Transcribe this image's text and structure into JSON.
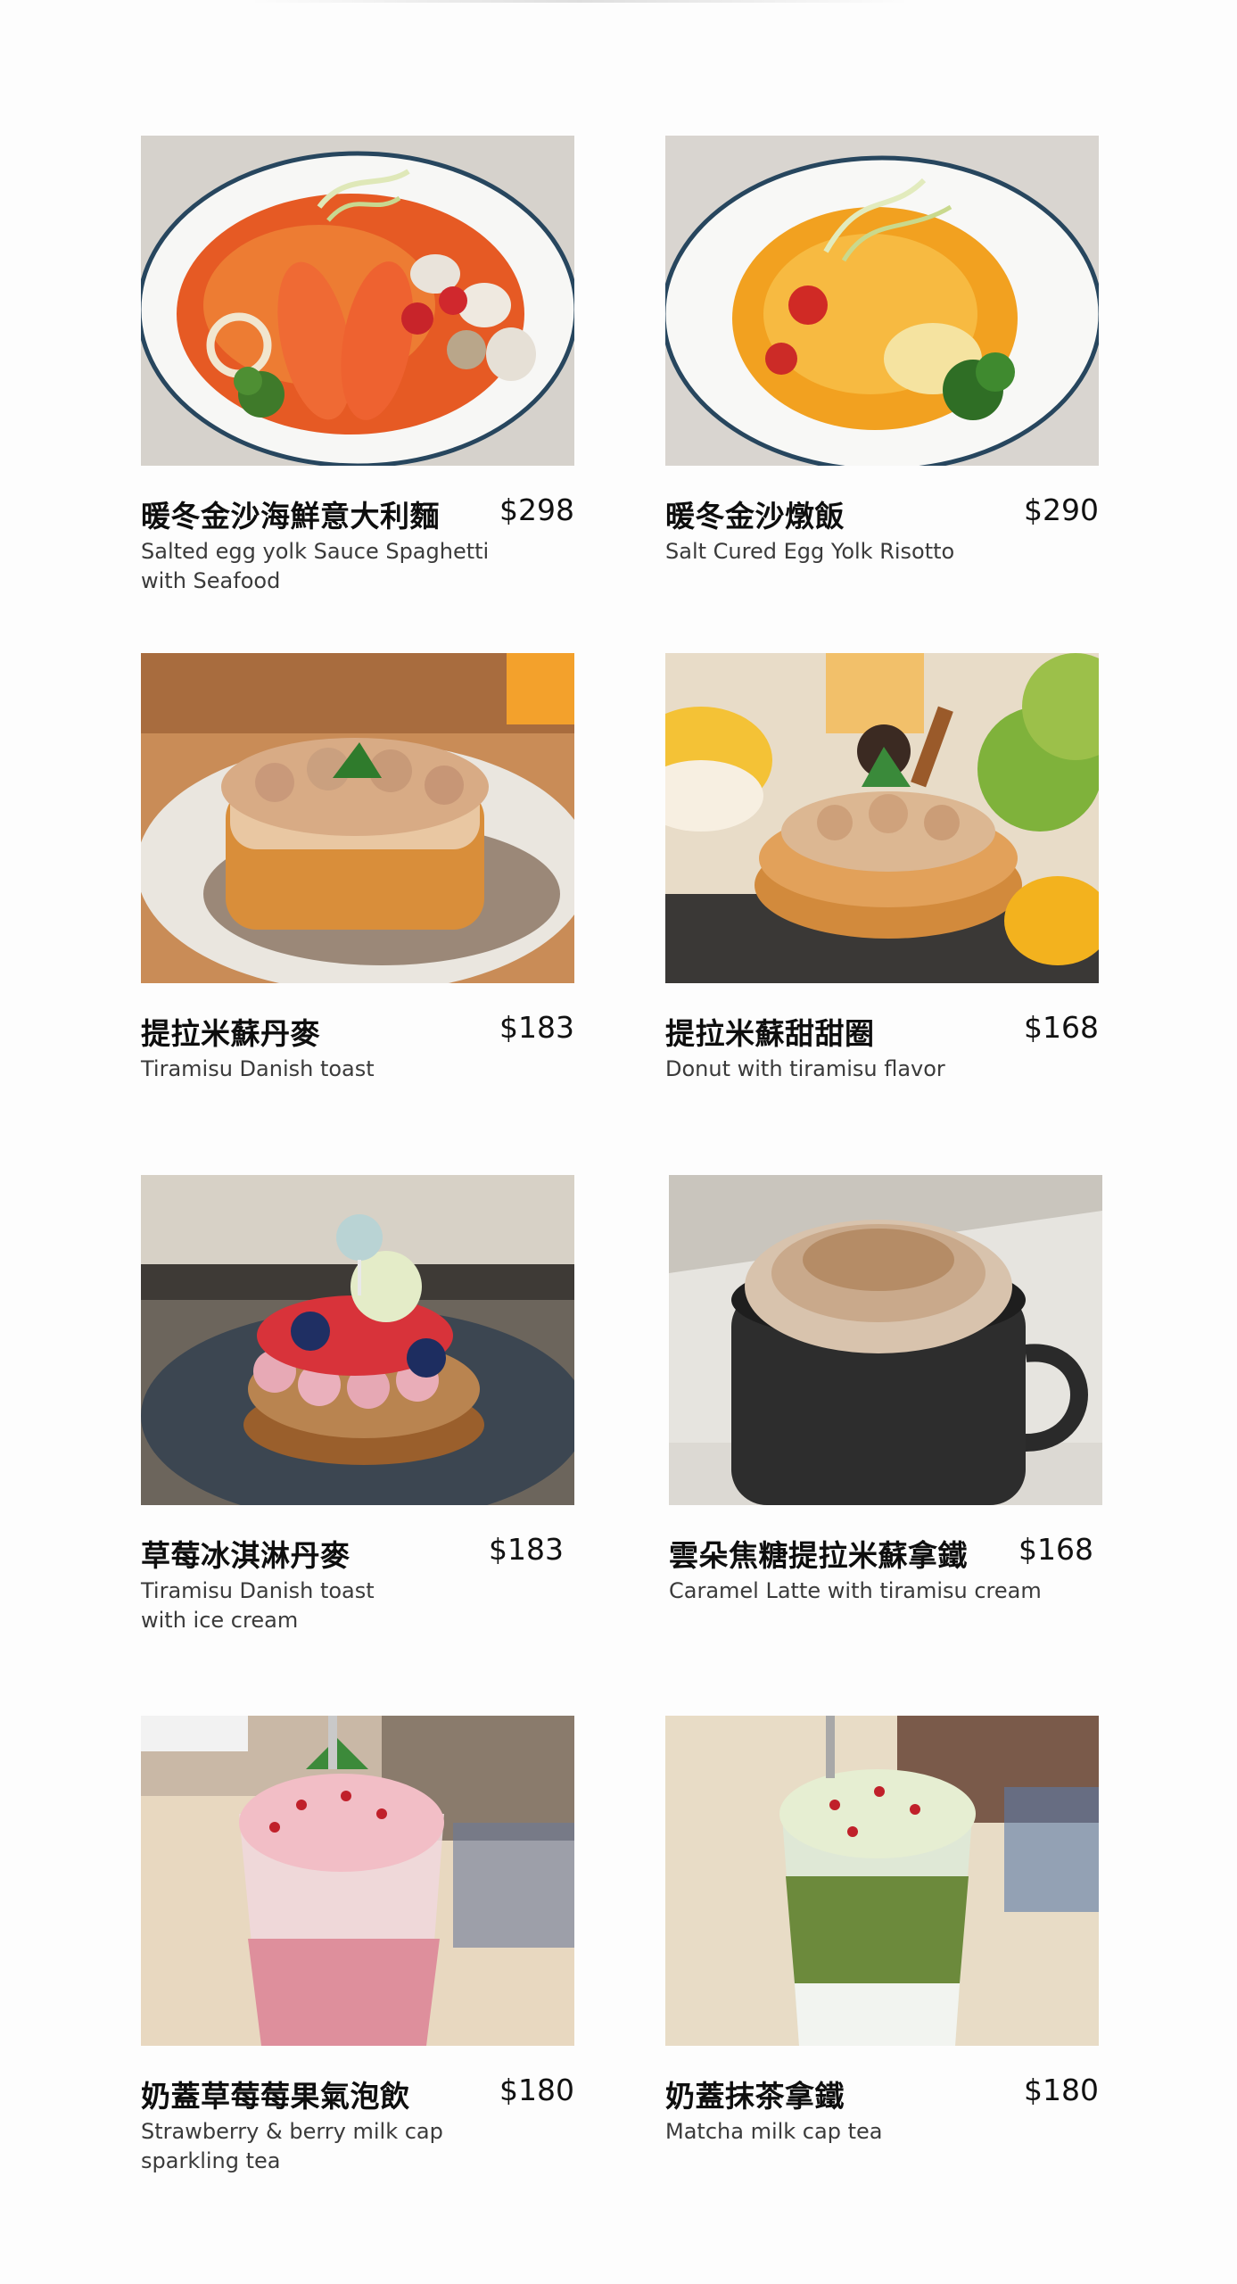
{
  "menu": {
    "items": [
      {
        "name": "暖冬金沙海鮮意大利麵",
        "price": "$298",
        "desc_line1": "Salted egg yolk Sauce Spaghetti",
        "desc_line2": "with Seafood",
        "photo": "seafood-spaghetti-photo"
      },
      {
        "name": "暖冬金沙燉飯",
        "price": "$290",
        "desc_line1": "Salt Cured Egg Yolk Risotto",
        "desc_line2": "",
        "photo": "risotto-photo"
      },
      {
        "name": "提拉米蘇丹麥",
        "price": "$183",
        "desc_line1": "Tiramisu Danish toast",
        "desc_line2": "",
        "photo": "tiramisu-danish-photo"
      },
      {
        "name": "提拉米蘇甜甜圈",
        "price": "$168",
        "desc_line1": "Donut with tiramisu flavor",
        "desc_line2": "",
        "photo": "tiramisu-donut-photo"
      },
      {
        "name": "草莓冰淇淋丹麥",
        "price": "$183",
        "desc_line1": "Tiramisu Danish toast",
        "desc_line2": "with ice cream",
        "photo": "strawberry-danish-photo"
      },
      {
        "name": "雲朵焦糖提拉米蘇拿鐵",
        "price": "$168",
        "desc_line1": "Caramel Latte with tiramisu cream",
        "desc_line2": "",
        "photo": "caramel-latte-photo"
      },
      {
        "name": "奶蓋草莓莓果氣泡飲",
        "price": "$180",
        "desc_line1": "Strawberry & berry milk cap",
        "desc_line2": "sparkling tea",
        "photo": "strawberry-sparkling-photo"
      },
      {
        "name": "奶蓋抹茶拿鐵",
        "price": "$180",
        "desc_line1": "Matcha milk cap tea",
        "desc_line2": "",
        "photo": "matcha-latte-photo"
      }
    ]
  }
}
